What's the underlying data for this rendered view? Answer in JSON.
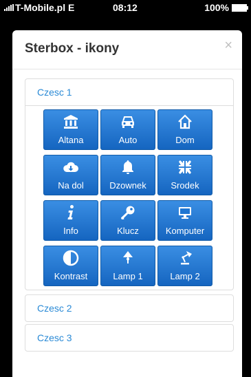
{
  "status_bar": {
    "carrier": "T-Mobile.pl  E",
    "time": "08:12",
    "battery": "100%"
  },
  "modal": {
    "title": "Sterbox - ikony",
    "close_glyph": "×"
  },
  "panels": [
    {
      "label": "Czesc 1"
    },
    {
      "label": "Czesc 2"
    },
    {
      "label": "Czesc 3"
    }
  ],
  "tiles": [
    {
      "label": "Altana",
      "icon": "bank-icon"
    },
    {
      "label": "Auto",
      "icon": "car-icon"
    },
    {
      "label": "Dom",
      "icon": "home-icon"
    },
    {
      "label": "Na dol",
      "icon": "cloud-download-icon"
    },
    {
      "label": "Dzownek",
      "icon": "bell-icon"
    },
    {
      "label": "Srodek",
      "icon": "compress-icon"
    },
    {
      "label": "Info",
      "icon": "info-icon"
    },
    {
      "label": "Klucz",
      "icon": "key-icon"
    },
    {
      "label": "Komputer",
      "icon": "desktop-icon"
    },
    {
      "label": "Kontrast",
      "icon": "adjust-icon"
    },
    {
      "label": "Lamp 1",
      "icon": "lamp-icon"
    },
    {
      "label": "Lamp 2",
      "icon": "desk-lamp-icon"
    }
  ],
  "colors": {
    "tile_top": "#3a8ee3",
    "tile_bottom": "#1565c0",
    "link": "#2a8ad6"
  }
}
